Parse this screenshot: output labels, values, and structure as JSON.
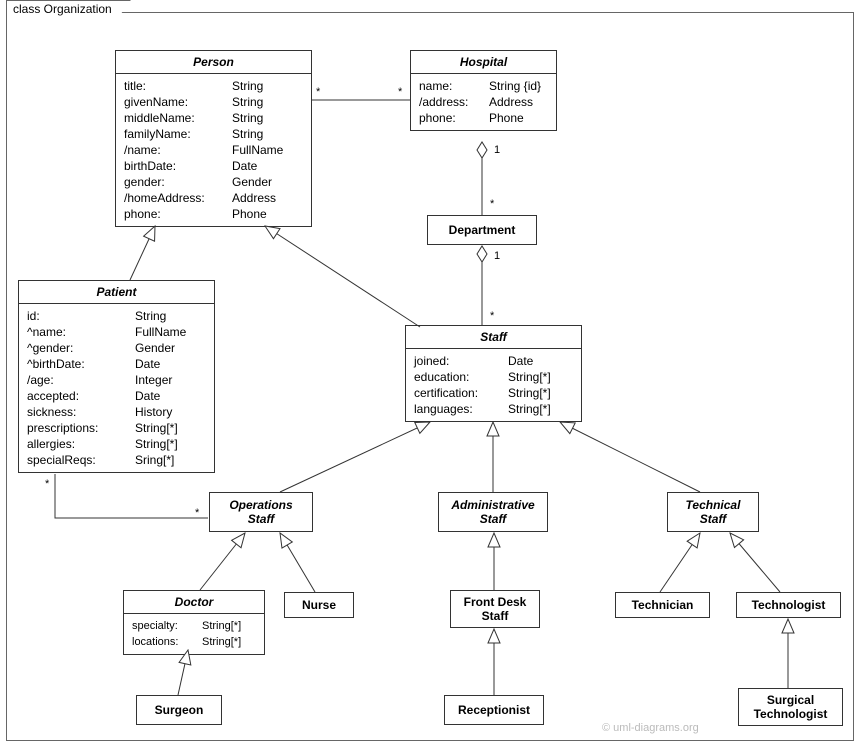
{
  "frame": {
    "title": "class Organization"
  },
  "watermark": "© uml-diagrams.org",
  "classes": {
    "person": {
      "name": "Person",
      "attrs": [
        {
          "n": "title:",
          "t": "String"
        },
        {
          "n": "givenName:",
          "t": "String"
        },
        {
          "n": "middleName:",
          "t": "String"
        },
        {
          "n": "familyName:",
          "t": "String"
        },
        {
          "n": "/name:",
          "t": "FullName"
        },
        {
          "n": "birthDate:",
          "t": "Date"
        },
        {
          "n": "gender:",
          "t": "Gender"
        },
        {
          "n": "/homeAddress:",
          "t": "Address"
        },
        {
          "n": "phone:",
          "t": "Phone"
        }
      ]
    },
    "hospital": {
      "name": "Hospital",
      "attrs": [
        {
          "n": "name:",
          "t": "String {id}"
        },
        {
          "n": "/address:",
          "t": "Address"
        },
        {
          "n": "phone:",
          "t": "Phone"
        }
      ]
    },
    "patient": {
      "name": "Patient",
      "attrs": [
        {
          "n": "id:",
          "t": "String"
        },
        {
          "n": "^name:",
          "t": "FullName"
        },
        {
          "n": "^gender:",
          "t": "Gender"
        },
        {
          "n": "^birthDate:",
          "t": "Date"
        },
        {
          "n": "/age:",
          "t": "Integer"
        },
        {
          "n": "accepted:",
          "t": "Date"
        },
        {
          "n": "sickness:",
          "t": "History"
        },
        {
          "n": "prescriptions:",
          "t": "String[*]"
        },
        {
          "n": "allergies:",
          "t": "String[*]"
        },
        {
          "n": "specialReqs:",
          "t": "Sring[*]"
        }
      ]
    },
    "department": {
      "name": "Department"
    },
    "staff": {
      "name": "Staff",
      "attrs": [
        {
          "n": "joined:",
          "t": "Date"
        },
        {
          "n": "education:",
          "t": "String[*]"
        },
        {
          "n": "certification:",
          "t": "String[*]"
        },
        {
          "n": "languages:",
          "t": "String[*]"
        }
      ]
    },
    "operationsStaff": {
      "name": "Operations\nStaff"
    },
    "administrativeStaff": {
      "name": "Administrative\nStaff"
    },
    "technicalStaff": {
      "name": "Technical\nStaff"
    },
    "doctor": {
      "name": "Doctor",
      "attrs": [
        {
          "n": "specialty:",
          "t": "String[*]"
        },
        {
          "n": "locations:",
          "t": "String[*]"
        }
      ]
    },
    "nurse": {
      "name": "Nurse"
    },
    "frontDeskStaff": {
      "name": "Front Desk\nStaff"
    },
    "technician": {
      "name": "Technician"
    },
    "technologist": {
      "name": "Technologist"
    },
    "surgeon": {
      "name": "Surgeon"
    },
    "receptionist": {
      "name": "Receptionist"
    },
    "surgicalTechnologist": {
      "name": "Surgical\nTechnologist"
    }
  },
  "multiplicities": {
    "personHospL": "*",
    "personHospR": "*",
    "hospDept1": "1",
    "hospDeptStar": "*",
    "deptStaff1": "1",
    "deptStaffStar": "*",
    "patientOpsL": "*",
    "patientOpsR": "*"
  }
}
